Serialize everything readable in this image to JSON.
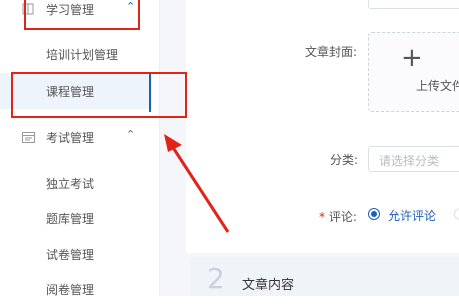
{
  "sidebar": {
    "groups": [
      {
        "label": "学习管理",
        "caret": "⌃",
        "icon": "book-icon"
      },
      {
        "label": "考试管理",
        "caret": "⌃",
        "icon": "calendar-icon"
      }
    ],
    "study_items": [
      {
        "label": "培训计划管理"
      },
      {
        "label": "课程管理"
      }
    ],
    "exam_items": [
      {
        "label": "独立考试"
      },
      {
        "label": "题库管理"
      },
      {
        "label": "试卷管理"
      },
      {
        "label": "阅卷管理"
      }
    ]
  },
  "form": {
    "cover_label": "文章封面:",
    "upload_plus": "+",
    "upload_text": "上传文件",
    "category_label": "分类:",
    "category_placeholder": "请选择分类",
    "comment_required": "*",
    "comment_label": "评论:",
    "comment_option_allow": "允许评论"
  },
  "section": {
    "number": "2",
    "title": "文章内容"
  },
  "colors": {
    "accent": "#1e5fb8",
    "annotation": "#e2231a"
  }
}
